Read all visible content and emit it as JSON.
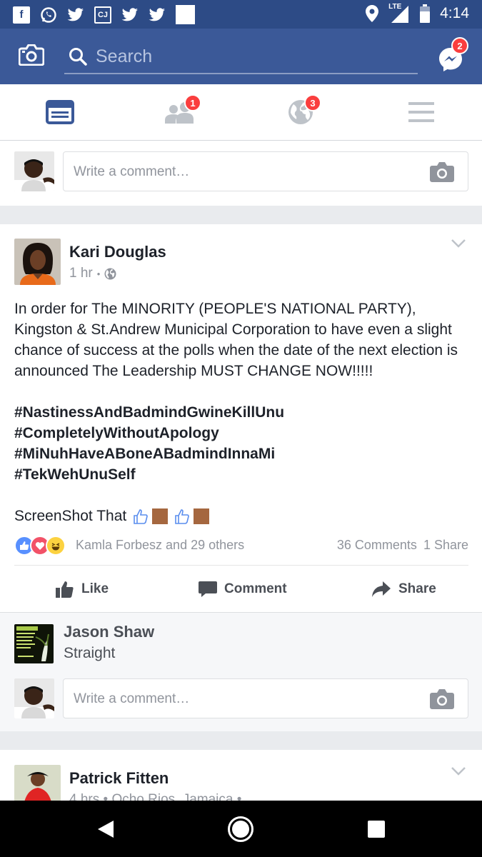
{
  "status_bar": {
    "left_icons": [
      "facebook-icon",
      "whatsapp-icon",
      "twitter-icon",
      "cj-app-icon",
      "twitter-icon",
      "twitter-icon",
      "blank-notification-icon"
    ],
    "cj_label": "CJ",
    "network": "LTE",
    "time": "4:14"
  },
  "header": {
    "search_placeholder": "Search",
    "messenger_badge": "2",
    "colors": {
      "header_bg": "#3b5998",
      "status_bg": "#2d4b86",
      "badge": "#fa3e3e"
    }
  },
  "tabs": [
    {
      "name": "news-feed",
      "icon": "news-feed-icon",
      "active": true,
      "badge": ""
    },
    {
      "name": "friend-requests",
      "icon": "friends-icon",
      "active": false,
      "badge": "1"
    },
    {
      "name": "notifications",
      "icon": "globe-icon",
      "active": false,
      "badge": "3"
    },
    {
      "name": "more",
      "icon": "menu-icon",
      "active": false,
      "badge": ""
    }
  ],
  "composer": {
    "placeholder": "Write a comment…"
  },
  "post": {
    "author": "Kari Douglas",
    "time": "1 hr",
    "separator": "•",
    "body": "In order for The MINORITY (PEOPLE'S NATIONAL PARTY), Kingston & St.Andrew Municipal Corporation to have even a slight chance of success at the polls when the date of the next election is announced The Leadership MUST CHANGE NOW!!!!!",
    "hashtags": [
      "#NastinessAndBadmindGwineKillUnu",
      "#CompletelyWithoutApology",
      "#MiNuhHaveABoneABadmindInnaMi",
      "#TekWehUnuSelf"
    ],
    "closing_line": "ScreenShot That",
    "reaction_names": "Kamla Forbesz and 29 others",
    "comment_count": "36 Comments",
    "share_count": "1 Share",
    "actions": {
      "like": "Like",
      "comment": "Comment",
      "share": "Share"
    }
  },
  "comment": {
    "author": "Jason Shaw",
    "text": "Straight",
    "reply_placeholder": "Write a comment…"
  },
  "post2": {
    "author": "Patrick Fitten",
    "meta": "4 hrs • Ocho Rios, Jamaica •"
  }
}
